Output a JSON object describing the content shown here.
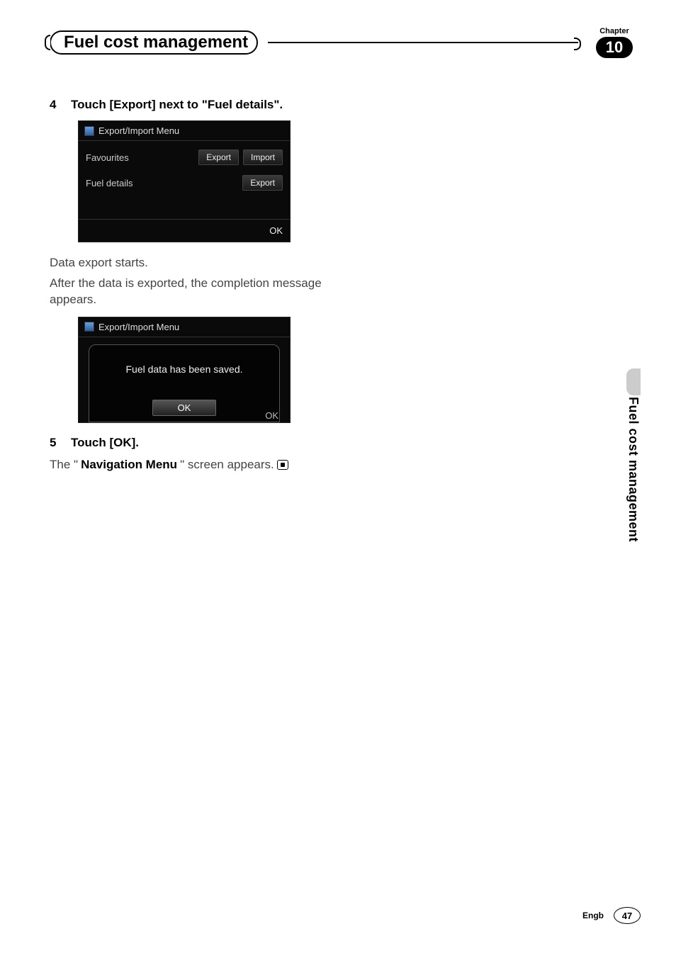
{
  "chapter": {
    "label": "Chapter",
    "number": "10",
    "title": "Fuel cost management"
  },
  "sidetab": "Fuel cost management",
  "steps": {
    "s4": {
      "num": "4",
      "text": "Touch [Export] next to \"Fuel details\"."
    },
    "s5": {
      "num": "5",
      "text": "Touch [OK]."
    }
  },
  "paragraphs": {
    "export_starts": "Data export starts.",
    "after_export": "After the data is exported, the completion message appears.",
    "result_prefix": "The \"",
    "result_bold": "Navigation Menu",
    "result_suffix": "\" screen appears."
  },
  "screenshot1": {
    "title": "Export/Import Menu",
    "row_favourites": "Favourites",
    "row_fueldetails": "Fuel details",
    "btn_export": "Export",
    "btn_import": "Import",
    "footer_ok": "OK"
  },
  "screenshot2": {
    "title": "Export/Import Menu",
    "message": "Fuel data has been saved.",
    "ok": "OK",
    "bg_ok": "OK"
  },
  "footer": {
    "lang": "Engb",
    "page": "47"
  }
}
